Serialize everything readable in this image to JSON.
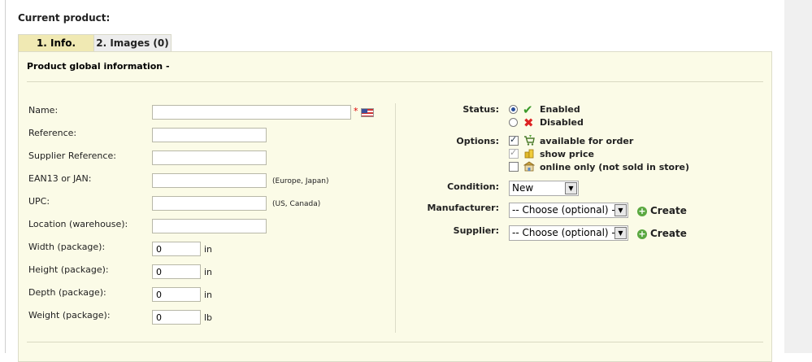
{
  "page_title": "Current product:",
  "tabs": [
    {
      "label": "1. Info.",
      "active": true
    },
    {
      "label": "2. Images (0)",
      "active": false
    }
  ],
  "panel_title": "Product global information -",
  "left_fields": [
    {
      "label": "Name:",
      "value": "",
      "required_mark": "*",
      "flag_icon": "us-flag-icon"
    },
    {
      "label": "Reference:",
      "value": ""
    },
    {
      "label": "Supplier Reference:",
      "value": ""
    },
    {
      "label": "EAN13 or JAN:",
      "value": "",
      "note": "(Europe, Japan)"
    },
    {
      "label": "UPC:",
      "value": "",
      "note": "(US, Canada)"
    },
    {
      "label": "Location (warehouse):",
      "value": ""
    },
    {
      "label": "Width (package):",
      "value": "0",
      "unit": "in"
    },
    {
      "label": "Height (package):",
      "value": "0",
      "unit": "in"
    },
    {
      "label": "Depth (package):",
      "value": "0",
      "unit": "in"
    },
    {
      "label": "Weight (package):",
      "value": "0",
      "unit": "lb"
    }
  ],
  "status": {
    "label": "Status:",
    "options": [
      {
        "label": "Enabled",
        "checked": true,
        "icon": "checkmark-icon"
      },
      {
        "label": "Disabled",
        "checked": false,
        "icon": "cross-icon"
      }
    ]
  },
  "options": {
    "label": "Options:",
    "items": [
      {
        "label": "available for order",
        "checked": true,
        "disabled": false,
        "icon": "cart-icon"
      },
      {
        "label": "show price",
        "checked": true,
        "disabled": true,
        "icon": "price-icon"
      },
      {
        "label": "online only (not sold in store)",
        "checked": false,
        "disabled": false,
        "icon": "store-icon"
      }
    ]
  },
  "condition": {
    "label": "Condition:",
    "selected": "New"
  },
  "manufacturer": {
    "label": "Manufacturer:",
    "selected": "-- Choose (optional) --",
    "create_label": "Create"
  },
  "supplier": {
    "label": "Supplier:",
    "selected": "-- Choose (optional) --",
    "create_label": "Create"
  }
}
